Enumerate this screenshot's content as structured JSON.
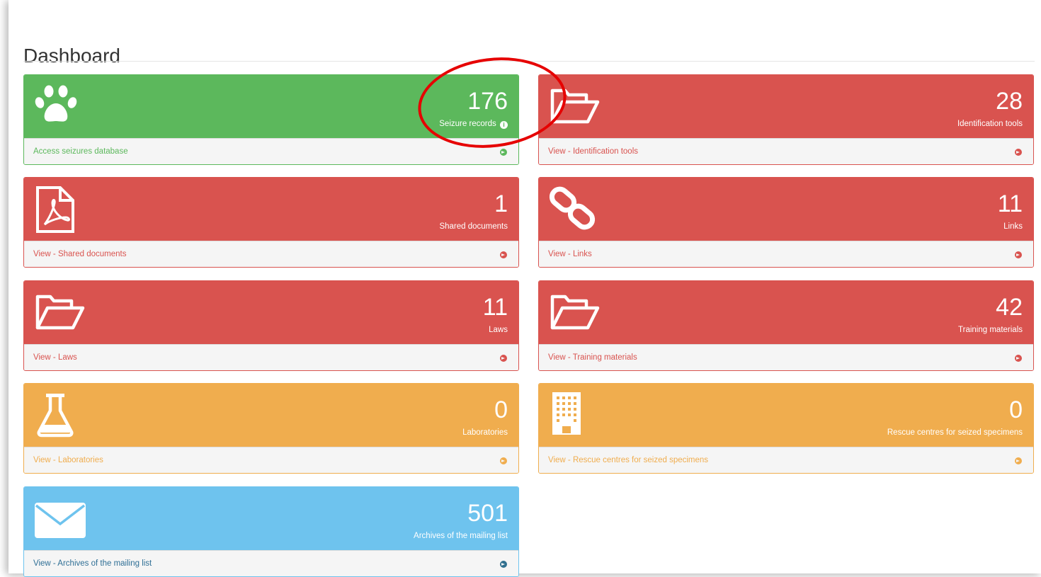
{
  "page": {
    "title": "Dashboard"
  },
  "cards": {
    "seizures": {
      "count": "176",
      "label": "Seizure records",
      "link": "Access seizures database",
      "icon": "paw-icon",
      "color": "#5cb85c"
    },
    "id_tools": {
      "count": "28",
      "label": "Identification tools",
      "link": "View - Identification tools",
      "icon": "folder-open-icon",
      "color": "#d9534f"
    },
    "shared_docs": {
      "count": "1",
      "label": "Shared documents",
      "link": "View - Shared documents",
      "icon": "pdf-file-icon",
      "color": "#d9534f"
    },
    "links": {
      "count": "11",
      "label": "Links",
      "link": "View - Links",
      "icon": "chain-link-icon",
      "color": "#d9534f"
    },
    "laws": {
      "count": "11",
      "label": "Laws",
      "link": "View - Laws",
      "icon": "folder-open-icon",
      "color": "#d9534f"
    },
    "training": {
      "count": "42",
      "label": "Training materials",
      "link": "View - Training materials",
      "icon": "folder-open-icon",
      "color": "#d9534f"
    },
    "labs": {
      "count": "0",
      "label": "Laboratories",
      "link": "View - Laboratories",
      "icon": "flask-icon",
      "color": "#f0ad4e"
    },
    "rescue": {
      "count": "0",
      "label": "Rescue centres for seized specimens",
      "link": "View - Rescue centres for seized specimens",
      "icon": "building-icon",
      "color": "#f0ad4e"
    },
    "mailing": {
      "count": "501",
      "label": "Archives of the mailing list",
      "link": "View - Archives of the mailing list",
      "icon": "envelope-icon",
      "color": "#6ec3ee"
    }
  },
  "info_glyph": "i"
}
